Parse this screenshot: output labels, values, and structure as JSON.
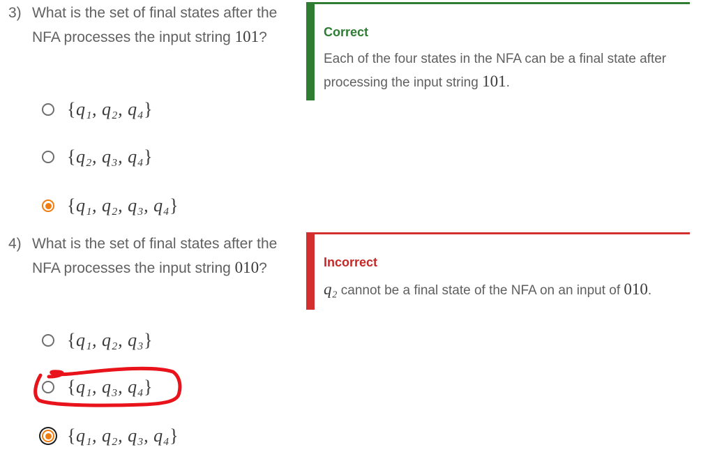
{
  "q3": {
    "number": "3)",
    "text_before": "What is the set of final states after the NFA processes the input string ",
    "math": "101",
    "text_after": "?",
    "options": [
      {
        "text": "{q1, q2, q4}",
        "inner": "q₁, q₂, q₄",
        "selected": false
      },
      {
        "text": "{q2, q3, q4}",
        "inner": "q₂, q₃, q₄",
        "selected": false
      },
      {
        "text": "{q1, q2, q3, q4}",
        "inner": "q₁, q₂, q₃, q₄",
        "selected": true
      }
    ],
    "feedback": {
      "status": "Correct",
      "body_before": "Each of the four states in the NFA can be a final state after processing the input string ",
      "math": "101",
      "body_after": ".",
      "color": "#2e7d32"
    }
  },
  "q4": {
    "number": "4)",
    "text_before": "What is the set of final states after the NFA processes the input string ",
    "math": "010",
    "text_after": "?",
    "options": [
      {
        "text": "{q1, q2, q3}",
        "inner": "q₁, q₂, q₃",
        "selected": false
      },
      {
        "text": "{q1, q3, q4}",
        "inner": "q₁, q₃, q₄",
        "selected": false,
        "circled_in_red": true
      },
      {
        "text": "{q1, q2, q3, q4}",
        "inner": "q₁, q₂, q₃, q₄",
        "selected": true,
        "focused": true
      }
    ],
    "feedback": {
      "status": "Incorrect",
      "math_before": "q₂",
      "body": " cannot be a final state of the NFA on an input of ",
      "math": "010",
      "body_after": ".",
      "color": "#c62828"
    }
  },
  "colors": {
    "accent_orange": "#f07d10",
    "correct_green": "#2e7d32",
    "incorrect_red": "#d32f2f",
    "annotation_red": "#e8131b"
  }
}
